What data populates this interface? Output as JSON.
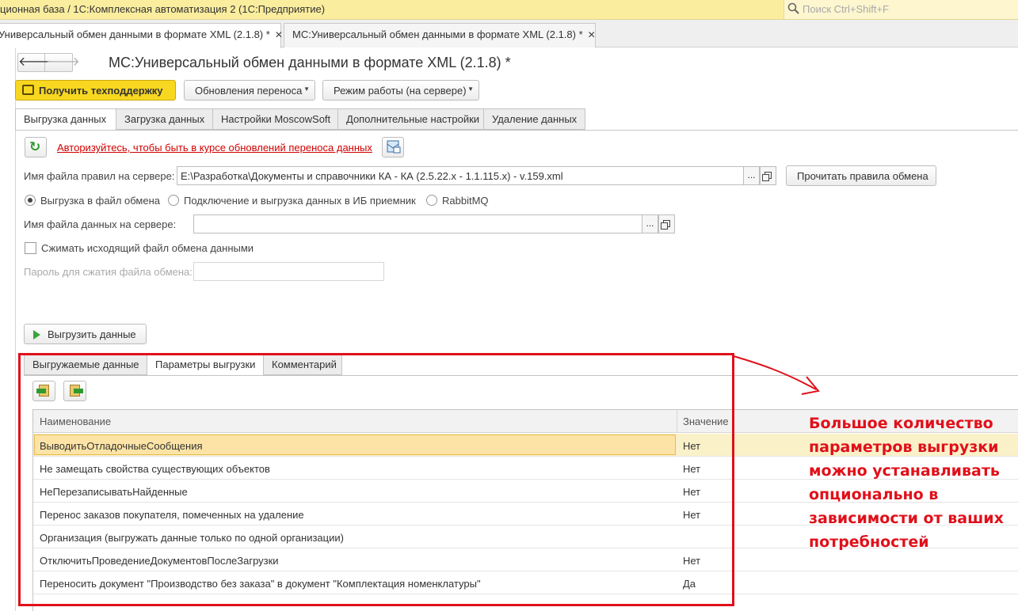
{
  "window": {
    "title": "ционная база / 1С:Комплексная автоматизация 2  (1С:Предприятие)",
    "search_placeholder": "Поиск Ctrl+Shift+F"
  },
  "window_tabs": [
    {
      "label": "Универсальный обмен данными в формате XML (2.1.8) *",
      "close": "✕",
      "active": true
    },
    {
      "label": "МС:Универсальный обмен данными в формате XML (2.1.8) *",
      "close": "✕",
      "active": false
    }
  ],
  "form": {
    "title": "МС:Универсальный обмен данными в формате XML (2.1.8) *",
    "nav_back": "🡐",
    "nav_forward": "🡒"
  },
  "commands": {
    "support": "Получить техподдержку",
    "updates": "Обновления переноса",
    "mode": "Режим работы (на сервере)"
  },
  "page_tabs": [
    "Выгрузка данных",
    "Загрузка данных",
    "Настройки MoscowSoft",
    "Дополнительные настройки",
    "Удаление данных"
  ],
  "auth_link": "Авторизуйтесь, чтобы быть в курсе обновлений переноса данных",
  "rules_file": {
    "label": "Имя файла правил на сервере:",
    "value": "E:\\Разработка\\Документы и справочники КА - КА (2.5.22.x - 1.1.115.x) - v.159.xml",
    "select_btn": "...",
    "read_btn": "Прочитать правила обмена"
  },
  "export_mode": {
    "options": [
      "Выгрузка в файл обмена",
      "Подключение и выгрузка данных в ИБ приемник",
      "RabbitMQ"
    ],
    "selected": "Выгрузка в файл обмена"
  },
  "data_file": {
    "label": "Имя файла данных на сервере:",
    "value": "",
    "select_btn": "..."
  },
  "compress": {
    "label": "Сжимать исходящий файл обмена данными",
    "checked": false
  },
  "password": {
    "label": "Пароль для сжатия файла обмена:",
    "value": ""
  },
  "run_button": "Выгрузить данные",
  "inner_tabs": [
    "Выгружаемые данные",
    "Параметры выгрузки",
    "Комментарий"
  ],
  "inner_active": "Параметры выгрузки",
  "table": {
    "headers": [
      "Наименование",
      "Значение"
    ],
    "rows": [
      {
        "name": "ВыводитьОтладочныеСообщения",
        "value": "Нет"
      },
      {
        "name": "Не замещать свойства существующих объектов",
        "value": "Нет"
      },
      {
        "name": "НеПерезаписыватьНайденные",
        "value": "Нет"
      },
      {
        "name": "Перенос заказов покупателя, помеченных на удаление",
        "value": "Нет"
      },
      {
        "name": "Организация (выгружать данные только по одной организации)",
        "value": ""
      },
      {
        "name": "ОтключитьПроведениеДокументовПослеЗагрузки",
        "value": "Нет"
      },
      {
        "name": "Переносить документ \"Производство без заказа\" в документ \"Комплектация номенклатуры\"",
        "value": "Да"
      }
    ],
    "selected_row": 0
  },
  "annotation": {
    "lines": [
      "Большое количество",
      "параметров выгрузки",
      "можно устанавливать",
      "опционально в",
      "зависимости от ваших",
      "потребностей"
    ],
    "color": "#e0101a"
  },
  "colors": {
    "titlebar": "#fbed9e",
    "support_button": "#f7d720",
    "selection": "#fde4a6",
    "link_red": "#d00000"
  }
}
